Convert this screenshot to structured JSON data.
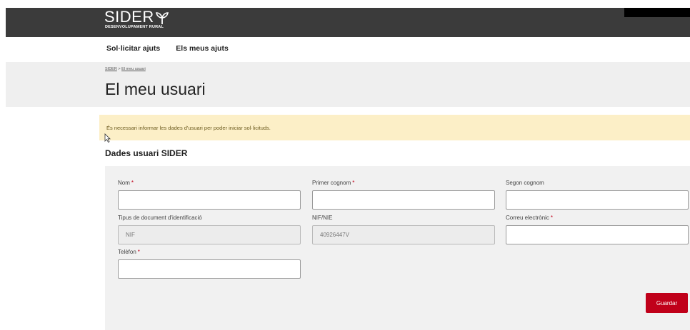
{
  "header": {
    "logo_text": "SIDER",
    "logo_subtitle": "DESENVOLUPAMENT RURAL"
  },
  "nav": {
    "items": [
      {
        "label": "Sol·licitar ajuts"
      },
      {
        "label": "Els meus ajuts"
      }
    ]
  },
  "breadcrumb": {
    "home": "SIDER",
    "separator": " > ",
    "current": "El meu usuari"
  },
  "page": {
    "title": "El meu usuari"
  },
  "alert": {
    "message": "És necessari informar les dades d'usuari per poder iniciar sol·licituds."
  },
  "form": {
    "section_title": "Dades usuari SIDER",
    "required_marker": "*",
    "fields": {
      "nom": {
        "label": "Nom",
        "value": ""
      },
      "primer_cognom": {
        "label": "Primer cognom",
        "value": ""
      },
      "segon_cognom": {
        "label": "Segon cognom",
        "value": ""
      },
      "tipus_document": {
        "label": "Tipus de document d'identificació",
        "value": "NIF"
      },
      "nif_nie": {
        "label": "NIF/NIE",
        "value": "40926447V"
      },
      "correu": {
        "label": "Correu electrònic",
        "value": ""
      },
      "telefon": {
        "label": "Telèfon",
        "value": ""
      }
    },
    "save_label": "Guardar"
  },
  "colors": {
    "topbar": "#3b3b3b",
    "accent": "#c0001a",
    "alert_bg": "#fcefc7"
  }
}
